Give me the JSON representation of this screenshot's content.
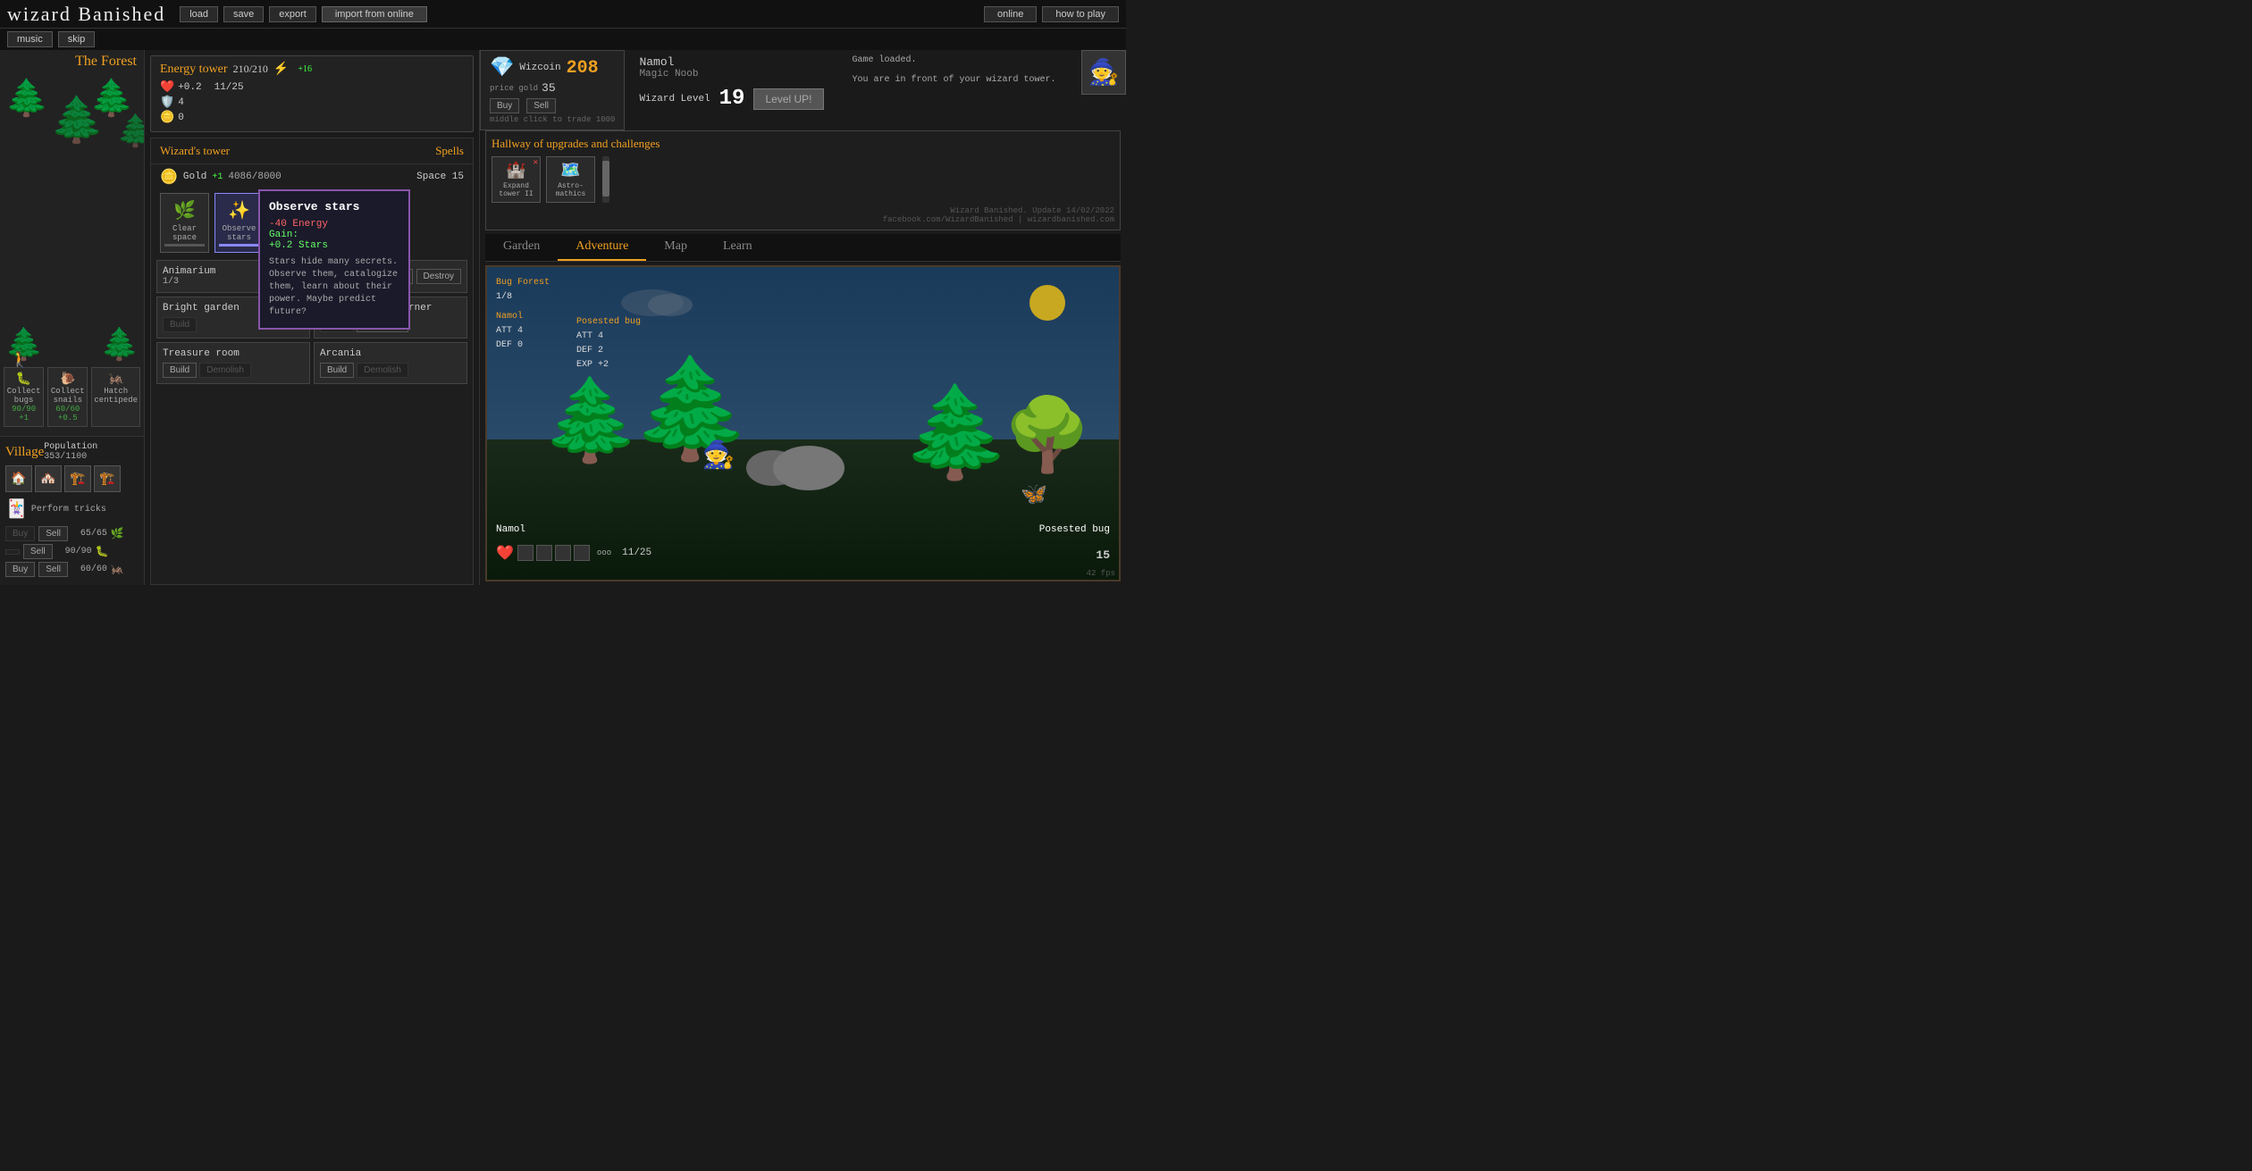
{
  "header": {
    "title": "wizard Banished",
    "buttons": {
      "load": "load",
      "save": "save",
      "export": "export",
      "import_online": "import from online",
      "online": "online",
      "how_to_play": "how to play"
    },
    "secondary": {
      "music": "music",
      "skip": "skip"
    }
  },
  "forest": {
    "title": "The Forest",
    "subtitle": "Walk",
    "items": [
      {
        "label": "Collect\nbugs",
        "count": "90/90",
        "bonus": "+1",
        "icon": "🐛"
      },
      {
        "label": "Collect\nsnails",
        "count": "60/60",
        "bonus": "+0.5",
        "icon": "🐌"
      },
      {
        "label": "Hatch\ncentipede",
        "count": "",
        "bonus": "",
        "icon": "🦟"
      }
    ]
  },
  "energy_tower": {
    "title": "Energy tower",
    "current": "210",
    "max": "210",
    "bonus": "+16",
    "energy_regen": "+0.2",
    "energy_cap": "11/25",
    "stars": "4",
    "unknown": "0"
  },
  "wizard_tower": {
    "title": "Wizard's tower",
    "spells_title": "Spells",
    "gold_label": "Gold",
    "gold_bonus": "+1",
    "gold_amount": "4086/8000",
    "space_label": "Space",
    "space_val": "15",
    "spells": [
      {
        "name": "Clear space",
        "icon": "🌿",
        "active": false
      },
      {
        "name": "Observe stars",
        "icon": "✨",
        "active": true
      }
    ],
    "tooltip": {
      "title": "Observe stars",
      "cost": "-40 Energy",
      "gain_label": "Gain:",
      "gain_value": "+0.2 Stars",
      "desc": "Stars hide many secrets. Observe them, catalogize them, learn about their power. Maybe predict future?"
    },
    "animarium": {
      "name": "Animarium",
      "count": "1/3",
      "build": "Build",
      "destroy": "Destroy"
    },
    "rooms": [
      {
        "name": "Bright garden",
        "btns": [
          "Build"
        ]
      },
      {
        "name": "Adventurer's corner",
        "btns": [
          "Build",
          "Demolish"
        ]
      },
      {
        "name": "Treasure room",
        "btns": [
          "Build",
          "Demolish"
        ]
      },
      {
        "name": "Arcania",
        "btns": [
          "Build",
          "Demolish"
        ]
      }
    ]
  },
  "village": {
    "title": "Village",
    "population_label": "Population",
    "population": "353/1100",
    "perform_label": "Perform\ntricks",
    "trades": [
      {
        "buy": false,
        "sell": "Sell",
        "count": "65/65",
        "icon": "🌿"
      },
      {
        "buy": false,
        "sell": "Sell",
        "count": "90/90",
        "icon": "🐛"
      },
      {
        "buy": "Buy",
        "sell": "Sell",
        "count": "60/60",
        "icon": "🦟"
      }
    ]
  },
  "wizcoin": {
    "label": "Wizcoin",
    "value": "208",
    "price_label": "price\ngold",
    "price_value": "35",
    "buy": "Buy",
    "sell": "Sell",
    "note": "middle click to trade 1000"
  },
  "player": {
    "name": "Namol",
    "title": "Magic Noob",
    "wizard_level_label": "Wizard Level",
    "wizard_level": "19",
    "level_up": "Level UP!"
  },
  "news": {
    "text": "Game loaded.\n\nYou are in front of your wizard tower."
  },
  "hallway": {
    "title": "Hallway of upgrades and challenges",
    "items": [
      {
        "label": "Expand\ntower II",
        "icon": "🏰"
      },
      {
        "label": "Astro-\nmathics",
        "icon": "🗺️"
      }
    ],
    "update_text": "Wizard Banished. Update 14/02/2022",
    "update_link": "facebook.com/WizardBanished | wizardbanished.com"
  },
  "tabs": [
    "Garden",
    "Adventure",
    "Map",
    "Learn"
  ],
  "active_tab": "Adventure",
  "adventure": {
    "area": "Bug Forest",
    "area_progress": "1/8",
    "player_name": "Namol",
    "player_att": "4",
    "player_def": "0",
    "enemy_name": "Posested bug",
    "enemy_att": "4",
    "enemy_def": "2",
    "enemy_exp": "+2",
    "player_hp": "11/25",
    "enemy_hp": "15",
    "enemy_hp_label": "Posested bug"
  },
  "fps": "42 fps"
}
